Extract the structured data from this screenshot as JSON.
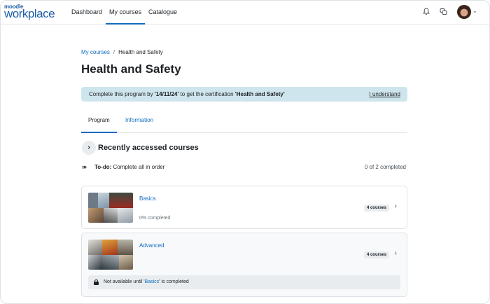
{
  "logo": {
    "small": "moodle",
    "big": "workplace"
  },
  "nav": {
    "links": [
      "Dashboard",
      "My courses",
      "Catalogue"
    ],
    "icons": [
      "bell-icon",
      "chat-icon"
    ]
  },
  "breadcrumb": {
    "parent": "My courses",
    "separator": "/",
    "current": "Health and Safety"
  },
  "page_title": "Health and Safety",
  "banner": {
    "prefix": "Complete this program by ",
    "date": "'14/11/24'",
    "middle": " to get the certification ",
    "cert": "'Health and Safety'",
    "dismiss": "I understand",
    "color": "#cfe5ed"
  },
  "tabs": [
    "Program",
    "Information"
  ],
  "recent": {
    "title": "Recently accessed courses"
  },
  "todo": {
    "label": "To-do:",
    "text": " Complete all in order",
    "progress": "0 of 2 completed"
  },
  "courses": [
    {
      "name": "Basics",
      "status": "0% completed",
      "count": "4 courses"
    },
    {
      "name": "Advanced",
      "count": "4 courses",
      "lock_prefix": "Not available until '",
      "lock_link": "Basics",
      "lock_suffix": "' is completed"
    }
  ],
  "colors": {
    "accent": "#0f6cbf",
    "text": "#1d2125"
  }
}
